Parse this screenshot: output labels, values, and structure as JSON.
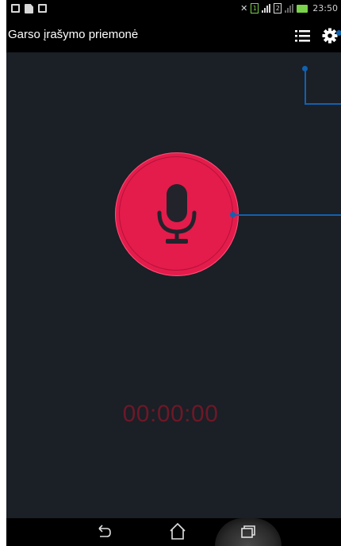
{
  "app": {
    "title": "Garso įrašymo priemonė"
  },
  "status_bar": {
    "time": "23:50",
    "sim1": "1",
    "sim2": "2"
  },
  "action_bar": {
    "list_icon": "list-icon",
    "settings_icon": "gear-icon"
  },
  "recorder": {
    "record_icon": "microphone-icon",
    "elapsed": "00:00:00"
  },
  "nav_bar": {
    "back_icon": "back-icon",
    "home_icon": "home-icon",
    "recent_icon": "recent-apps-icon"
  },
  "colors": {
    "background": "#1b1f26",
    "record_button": "#e41c4b",
    "timer_text": "#6d1828",
    "callout_line": "#1161b0"
  }
}
